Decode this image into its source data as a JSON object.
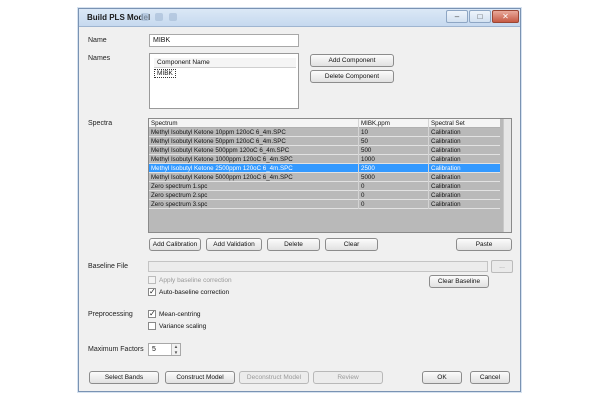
{
  "window": {
    "title": "Build PLS Model"
  },
  "name_field": {
    "label": "Name",
    "value": "MIBK"
  },
  "names": {
    "label": "Names",
    "column_header": "Component Name",
    "items": [
      "MIBK"
    ],
    "add_button": "Add Component",
    "delete_button": "Delete Component"
  },
  "spectra": {
    "label": "Spectra",
    "columns": [
      "Spectrum",
      "MIBK,ppm",
      "Spectral Set"
    ],
    "rows": [
      [
        "Methyl Isobutyl Ketone 10ppm 120oC 6_4m.SPC",
        "10",
        "Calibration"
      ],
      [
        "Methyl Isobutyl Ketone 50ppm 120oC 6_4m.SPC",
        "50",
        "Calibration"
      ],
      [
        "Methyl Isobutyl Ketone 500ppm 120oC 6_4m.SPC",
        "500",
        "Calibration"
      ],
      [
        "Methyl Isobutyl Ketone 1000ppm 120oC 6_4m.SPC",
        "1000",
        "Calibration"
      ],
      [
        "Methyl Isobutyl Ketone 2500ppm 120oC 6_4m.SPC",
        "2500",
        "Calibration"
      ],
      [
        "Methyl Isobutyl Ketone 5000ppm 120oC 6_4m.SPC",
        "5000",
        "Calibration"
      ],
      [
        "Zero spectrum 1.spc",
        "0",
        "Calibration"
      ],
      [
        "Zero spectrum 2.spc",
        "0",
        "Calibration"
      ],
      [
        "Zero spectrum 3.spc",
        "0",
        "Calibration"
      ]
    ],
    "selected_row": 4,
    "buttons": {
      "add_calibration": "Add Calibration",
      "add_validation": "Add Validation",
      "delete": "Delete",
      "clear": "Clear",
      "paste": "Paste"
    }
  },
  "baseline": {
    "label": "Baseline File",
    "value": "",
    "browse": "...",
    "apply_correction": {
      "label": "Apply baseline correction",
      "checked": false,
      "enabled": false
    },
    "auto_correction": {
      "label": "Auto-baseline correction",
      "checked": true,
      "enabled": true
    },
    "clear_button": "Clear Baseline"
  },
  "preprocessing": {
    "label": "Preprocessing",
    "mean_centring": {
      "label": "Mean-centring",
      "checked": true
    },
    "variance_scaling": {
      "label": "Variance scaling",
      "checked": false
    }
  },
  "max_factors": {
    "label": "Maximum Factors",
    "value": "5"
  },
  "footer": {
    "select_bands": "Select Bands",
    "construct_model": "Construct Model",
    "deconstruct_model": "Deconstruct Model",
    "review": "Review",
    "ok": "OK",
    "cancel": "Cancel"
  }
}
